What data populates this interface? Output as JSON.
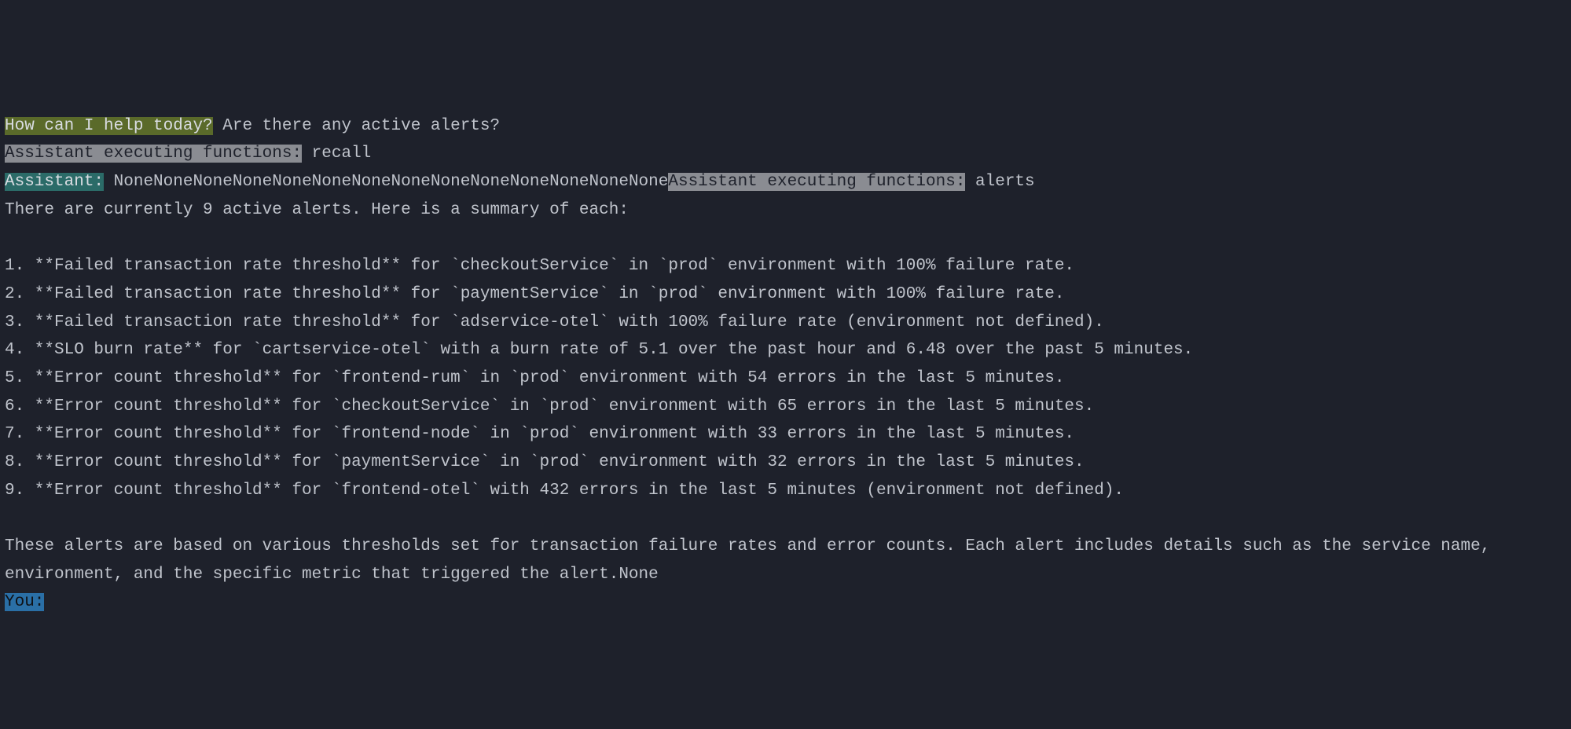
{
  "prompt": {
    "greeting": "How can I help today?",
    "user_question": " Are there any active alerts?"
  },
  "exec1": {
    "label": "Assistant executing functions:",
    "fn": " recall"
  },
  "assistant1": {
    "label": "Assistant:",
    "nones": " NoneNoneNoneNoneNoneNoneNoneNoneNoneNoneNoneNoneNoneNone"
  },
  "exec2": {
    "label": "Assistant executing functions:",
    "fn": " alerts"
  },
  "summary_intro": "There are currently 9 active alerts. Here is a summary of each:",
  "alerts": [
    "1. **Failed transaction rate threshold** for `checkoutService` in `prod` environment with 100% failure rate.",
    "2. **Failed transaction rate threshold** for `paymentService` in `prod` environment with 100% failure rate.",
    "3. **Failed transaction rate threshold** for `adservice-otel` with 100% failure rate (environment not defined).",
    "4. **SLO burn rate** for `cartservice-otel` with a burn rate of 5.1 over the past hour and 6.48 over the past 5 minutes.",
    "5. **Error count threshold** for `frontend-rum` in `prod` environment with 54 errors in the last 5 minutes.",
    "6. **Error count threshold** for `checkoutService` in `prod` environment with 65 errors in the last 5 minutes.",
    "7. **Error count threshold** for `frontend-node` in `prod` environment with 33 errors in the last 5 minutes.",
    "8. **Error count threshold** for `paymentService` in `prod` environment with 32 errors in the last 5 minutes.",
    "9. **Error count threshold** for `frontend-otel` with 432 errors in the last 5 minutes (environment not defined)."
  ],
  "summary_outro": "These alerts are based on various thresholds set for transaction failure rates and error counts. Each alert includes details such as the service name, environment, and the specific metric that triggered the alert.None",
  "you_label": "You:"
}
